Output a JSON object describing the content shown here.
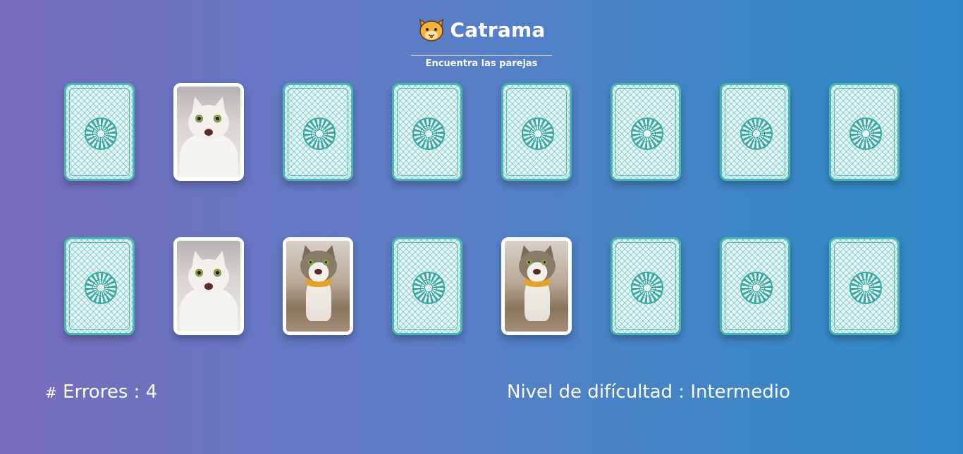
{
  "header": {
    "icon": "cat-face-icon",
    "title": "Catrama",
    "subtitle": "Encuentra las parejas"
  },
  "board": {
    "rows": [
      [
        {
          "state": "face-down"
        },
        {
          "state": "face-up",
          "image": "white-cat"
        },
        {
          "state": "face-down"
        },
        {
          "state": "face-down"
        },
        {
          "state": "face-down"
        },
        {
          "state": "face-down"
        },
        {
          "state": "face-down"
        },
        {
          "state": "face-down"
        }
      ],
      [
        {
          "state": "face-down"
        },
        {
          "state": "face-up",
          "image": "white-cat"
        },
        {
          "state": "face-up",
          "image": "tabby-cat"
        },
        {
          "state": "face-down"
        },
        {
          "state": "face-up",
          "image": "tabby-cat"
        },
        {
          "state": "face-down"
        },
        {
          "state": "face-down"
        },
        {
          "state": "face-down"
        }
      ]
    ]
  },
  "status": {
    "errors_hash": "#",
    "errors_label": "Errores : 4",
    "difficulty_label": "Nivel de difícultad : Intermedio"
  },
  "colors": {
    "card_back": "#47b7b1",
    "background_left": "#766cbc",
    "background_right": "#2f88c6"
  }
}
